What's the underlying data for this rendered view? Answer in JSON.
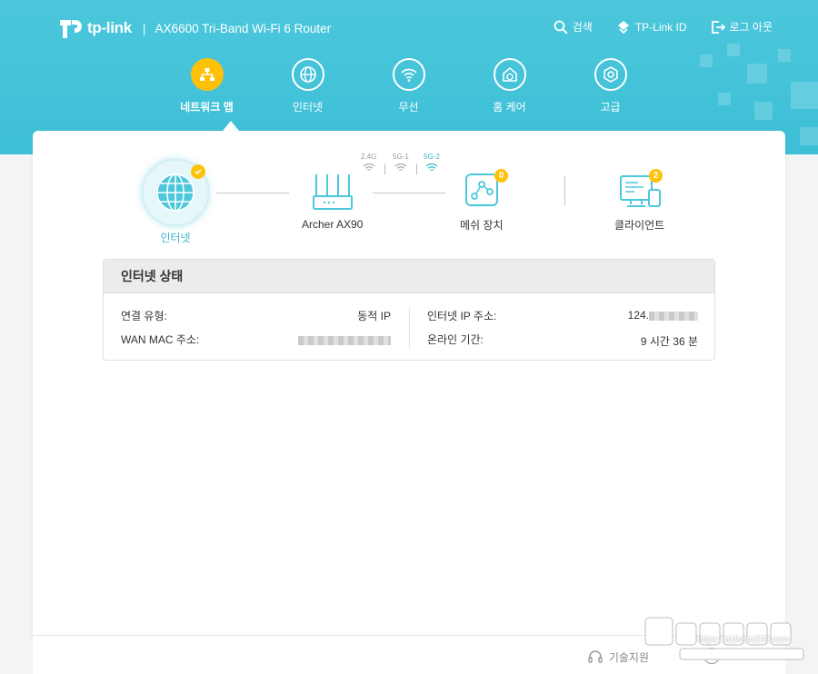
{
  "brand": {
    "logo": "tp-link",
    "model": "AX6600 Tri-Band Wi-Fi 6 Router"
  },
  "top_links": {
    "search": "검색",
    "account": "TP-Link ID",
    "logout": "로그 아웃"
  },
  "nav": [
    {
      "label": "네트워크 맵",
      "icon": "network-map-icon",
      "active": true
    },
    {
      "label": "인터넷",
      "icon": "globe-icon"
    },
    {
      "label": "무선",
      "icon": "wifi-icon"
    },
    {
      "label": "홈 케어",
      "icon": "home-care-icon"
    },
    {
      "label": "고급",
      "icon": "gear-icon"
    }
  ],
  "topology": {
    "internet": {
      "label": "인터넷",
      "status_icon": "check-icon"
    },
    "router": {
      "label": "Archer AX90"
    },
    "bands": [
      "2.4G",
      "5G-1",
      "5G-2"
    ],
    "active_band": "5G-2",
    "mesh": {
      "label": "메쉬 장치",
      "count": "0"
    },
    "clients": {
      "label": "클라이언트",
      "count": "2"
    }
  },
  "status": {
    "title": "인터넷 상태",
    "connection_type_label": "연결 유형:",
    "connection_type_value": "동적 IP",
    "wan_mac_label": "WAN MAC 주소:",
    "internet_ip_label": "인터넷 IP 주소:",
    "internet_ip_value": "124.",
    "uptime_label": "온라인 기간:",
    "uptime_value": "9 시간 36 분"
  },
  "footer": {
    "support": "기술지원"
  },
  "watermark": {
    "text": "https://aidsam209.com"
  },
  "colors": {
    "header": "#4cc7dc",
    "accent": "#ffc107",
    "teal": "#3ab5cc"
  }
}
